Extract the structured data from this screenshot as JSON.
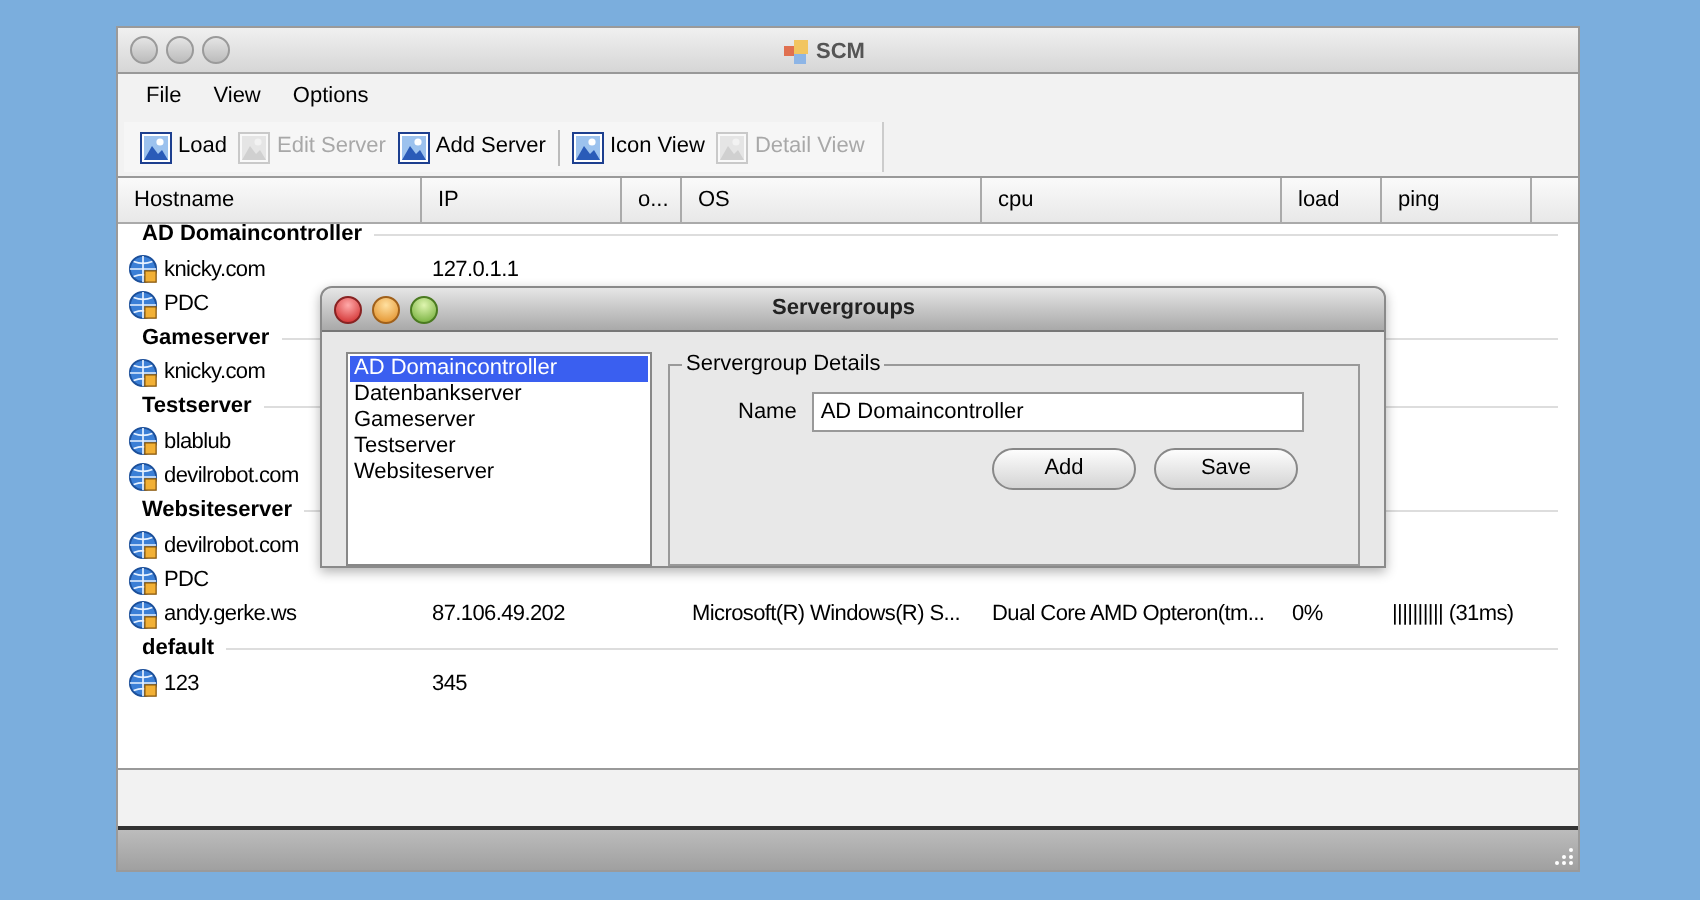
{
  "window": {
    "title": "SCM"
  },
  "menu": [
    "File",
    "View",
    "Options"
  ],
  "toolbar": [
    {
      "kind": "button",
      "label": "Load",
      "disabled": false
    },
    {
      "kind": "button",
      "label": "Edit Server",
      "disabled": true
    },
    {
      "kind": "button",
      "label": "Add Server",
      "disabled": false
    },
    {
      "kind": "separator"
    },
    {
      "kind": "button",
      "label": "Icon View",
      "disabled": false
    },
    {
      "kind": "button",
      "label": "Detail View",
      "disabled": true
    }
  ],
  "table": {
    "columns": [
      "Hostname",
      "IP",
      "o...",
      "OS",
      "cpu",
      "load",
      "ping"
    ],
    "groups": [
      {
        "name": "AD Domaincontroller",
        "rows": [
          {
            "hostname": "knicky.com",
            "ip": "127.0.1.1"
          },
          {
            "hostname": "PDC"
          }
        ]
      },
      {
        "name": "Gameserver",
        "rows": [
          {
            "hostname": "knicky.com"
          }
        ]
      },
      {
        "name": "Testserver",
        "rows": [
          {
            "hostname": "blablub"
          },
          {
            "hostname": "devilrobot.com"
          }
        ]
      },
      {
        "name": "Websiteserver",
        "rows": [
          {
            "hostname": "devilrobot.com"
          },
          {
            "hostname": "PDC"
          },
          {
            "hostname": "andy.gerke.ws",
            "ip": "87.106.49.202",
            "os": "Microsoft(R) Windows(R) S...",
            "cpu": "Dual Core AMD Opteron(tm...",
            "load": "0%",
            "ping": "|||||||||| (31ms)"
          }
        ]
      },
      {
        "name": "default",
        "rows": [
          {
            "hostname": "123",
            "ip": "345"
          }
        ]
      }
    ]
  },
  "dialog": {
    "title": "Servergroups",
    "groups": [
      {
        "label": "AD Domaincontroller",
        "selected": true
      },
      {
        "label": "Datenbankserver",
        "selected": false
      },
      {
        "label": "Gameserver",
        "selected": false
      },
      {
        "label": "Testserver",
        "selected": false
      },
      {
        "label": "Websiteserver",
        "selected": false
      }
    ],
    "details": {
      "legend": "Servergroup Details",
      "name_label": "Name",
      "name_value": "AD Domaincontroller"
    },
    "buttons": [
      "Add",
      "Save"
    ]
  }
}
